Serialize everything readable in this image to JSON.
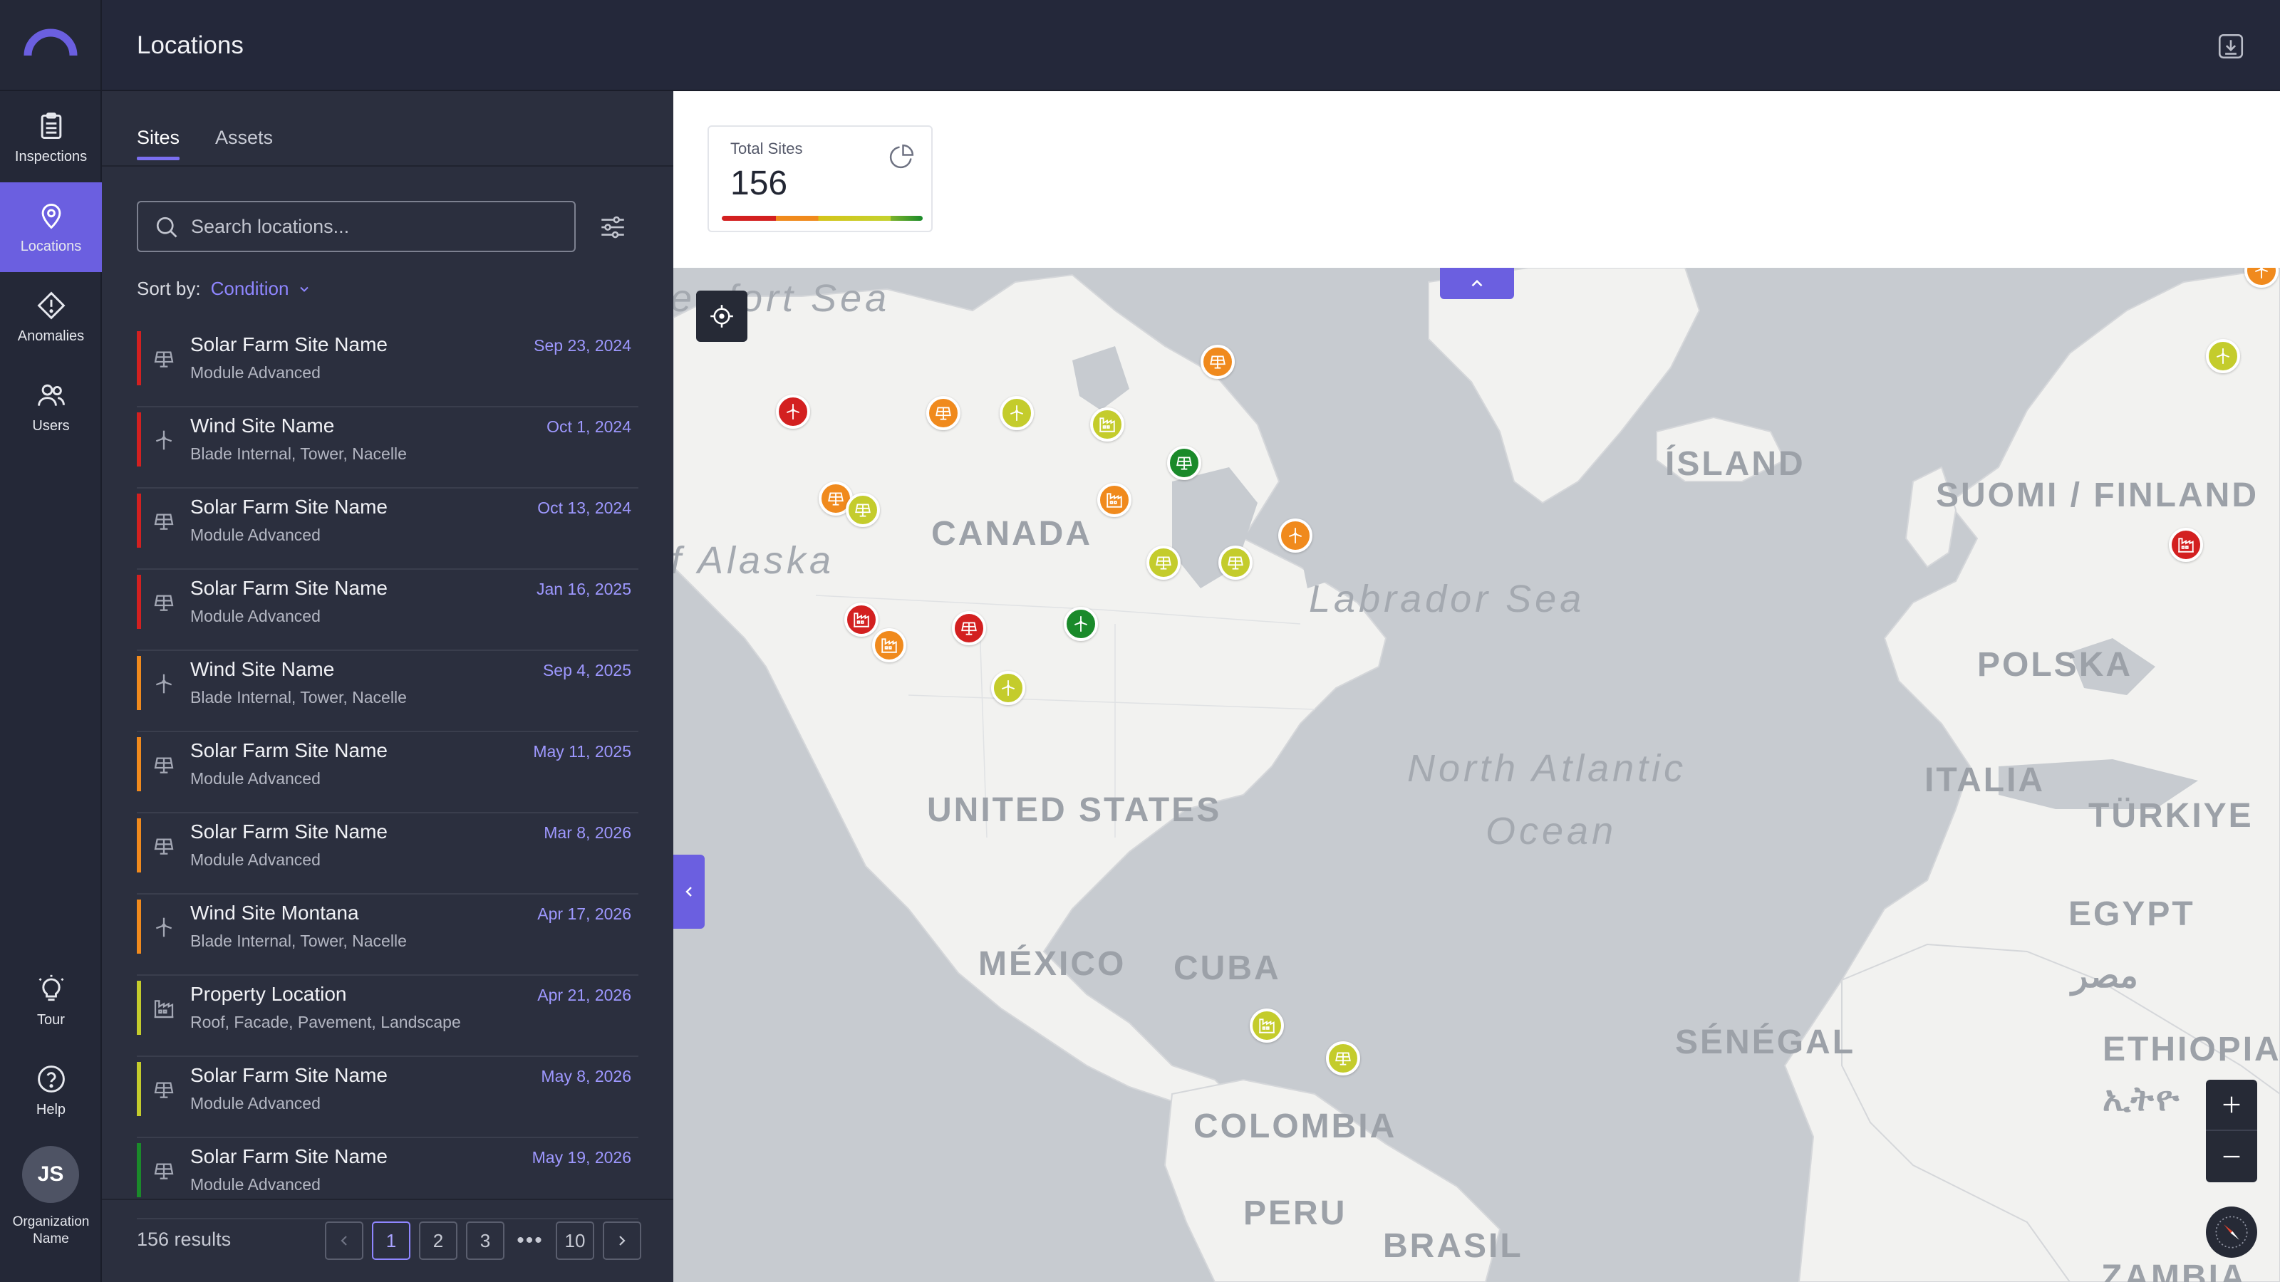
{
  "app": {
    "page_title": "Locations"
  },
  "rail": {
    "items": [
      {
        "label": "Inspections",
        "icon": "clipboard-icon"
      },
      {
        "label": "Locations",
        "icon": "map-pin-icon"
      },
      {
        "label": "Anomalies",
        "icon": "alert-diamond-icon"
      },
      {
        "label": "Users",
        "icon": "users-icon"
      }
    ],
    "bottom": [
      {
        "label": "Tour",
        "icon": "lightbulb-icon"
      },
      {
        "label": "Help",
        "icon": "help-circle-icon"
      }
    ],
    "avatar_initials": "JS",
    "org_name": "Organization Name"
  },
  "panel": {
    "tabs": [
      "Sites",
      "Assets"
    ],
    "active_tab": "Sites",
    "search_placeholder": "Search locations...",
    "sort_label": "Sort by:",
    "sort_value": "Condition",
    "results_text": "156 results",
    "pages": [
      "1",
      "2",
      "3",
      "•••",
      "10"
    ],
    "current_page": "1"
  },
  "colors": {
    "accent": "#6b5fe0",
    "critical": "#d32020",
    "high": "#f08a1d",
    "medium": "#c4cc2c",
    "good": "#1a8a2a"
  },
  "sites": [
    {
      "name": "Solar Farm Site Name",
      "sub": "Module Advanced",
      "date": "Sep 23, 2024",
      "type": "solar",
      "status": "critical"
    },
    {
      "name": "Wind Site Name",
      "sub": "Blade Internal, Tower, Nacelle",
      "date": "Oct 1, 2024",
      "type": "wind",
      "status": "critical"
    },
    {
      "name": "Solar Farm Site Name",
      "sub": "Module Advanced",
      "date": "Oct 13, 2024",
      "type": "solar",
      "status": "critical"
    },
    {
      "name": "Solar Farm Site Name",
      "sub": "Module Advanced",
      "date": "Jan 16, 2025",
      "type": "solar",
      "status": "critical"
    },
    {
      "name": "Wind Site Name",
      "sub": "Blade Internal, Tower, Nacelle",
      "date": "Sep 4, 2025",
      "type": "wind",
      "status": "high"
    },
    {
      "name": "Solar Farm Site Name",
      "sub": "Module Advanced",
      "date": "May 11, 2025",
      "type": "solar",
      "status": "high"
    },
    {
      "name": "Solar Farm Site Name",
      "sub": "Module Advanced",
      "date": "Mar 8, 2026",
      "type": "solar",
      "status": "high"
    },
    {
      "name": "Wind Site Montana",
      "sub": "Blade Internal, Tower, Nacelle",
      "date": "Apr 17, 2026",
      "type": "wind",
      "status": "high"
    },
    {
      "name": "Property Location",
      "sub": "Roof, Facade, Pavement, Landscape",
      "date": "Apr 21, 2026",
      "type": "property",
      "status": "medium"
    },
    {
      "name": "Solar Farm Site Name",
      "sub": "Module Advanced",
      "date": "May 8, 2026",
      "type": "solar",
      "status": "medium"
    },
    {
      "name": "Solar Farm Site Name",
      "sub": "Module Advanced",
      "date": "May 19, 2026",
      "type": "solar",
      "status": "good"
    }
  ],
  "summary": {
    "label": "Total Sites",
    "value": "156"
  },
  "map": {
    "labels": [
      {
        "text": "ewfort Sea",
        "kind": "sea"
      },
      {
        "text": "f Alaska",
        "kind": "sea"
      },
      {
        "text": "CANADA",
        "kind": "country"
      },
      {
        "text": "Labrador Sea",
        "kind": "sea"
      },
      {
        "text": "ÍSLAND",
        "kind": "country"
      },
      {
        "text": "SUOMI / FINLAND",
        "kind": "country"
      },
      {
        "text": "POLSKA",
        "kind": "country"
      },
      {
        "text": "ITALIA",
        "kind": "country"
      },
      {
        "text": "TÜRKIYE",
        "kind": "country"
      },
      {
        "text": "North Atlantic",
        "kind": "sea"
      },
      {
        "text": "Ocean",
        "kind": "sea"
      },
      {
        "text": "UNITED STATES",
        "kind": "country"
      },
      {
        "text": "MÉXICO",
        "kind": "country"
      },
      {
        "text": "CUBA",
        "kind": "country"
      },
      {
        "text": "EGYPT",
        "kind": "country"
      },
      {
        "text": "مصر",
        "kind": "country"
      },
      {
        "text": "SÉNÉGAL",
        "kind": "country"
      },
      {
        "text": "ETHIOPIA",
        "kind": "country"
      },
      {
        "text": "ኢትዮ",
        "kind": "country"
      },
      {
        "text": "COLOMBIA",
        "kind": "country"
      },
      {
        "text": "PERU",
        "kind": "country"
      },
      {
        "text": "BRASIL",
        "kind": "country"
      },
      {
        "text": "ZAMBIA",
        "kind": "country"
      }
    ],
    "markers": [
      {
        "type": "wind",
        "status": "critical"
      },
      {
        "type": "solar",
        "status": "high"
      },
      {
        "type": "wind",
        "status": "medium"
      },
      {
        "type": "property",
        "status": "medium"
      },
      {
        "type": "solar",
        "status": "high"
      },
      {
        "type": "solar",
        "status": "good"
      },
      {
        "type": "solar",
        "status": "high"
      },
      {
        "type": "solar",
        "status": "medium"
      },
      {
        "type": "property",
        "status": "high"
      },
      {
        "type": "solar",
        "status": "medium"
      },
      {
        "type": "solar",
        "status": "medium"
      },
      {
        "type": "wind",
        "status": "high"
      },
      {
        "type": "property",
        "status": "critical"
      },
      {
        "type": "solar",
        "status": "critical"
      },
      {
        "type": "wind",
        "status": "good"
      },
      {
        "type": "property",
        "status": "high"
      },
      {
        "type": "wind",
        "status": "medium"
      },
      {
        "type": "wind",
        "status": "high"
      },
      {
        "type": "wind",
        "status": "medium"
      },
      {
        "type": "property",
        "status": "critical"
      },
      {
        "type": "property",
        "status": "medium"
      },
      {
        "type": "solar",
        "status": "medium"
      }
    ]
  }
}
